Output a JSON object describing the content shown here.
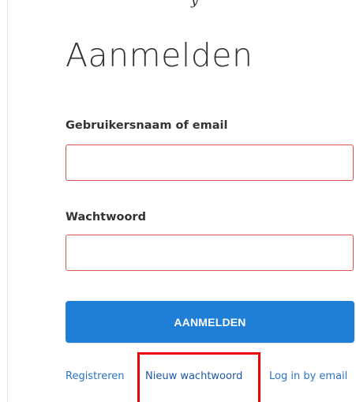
{
  "top_fragment": "y",
  "login": {
    "title": "Aanmelden",
    "username_label": "Gebruikersnaam of email",
    "username_value": "",
    "password_label": "Wachtwoord",
    "password_value": "",
    "submit_label": "AANMELDEN"
  },
  "links": {
    "register": "Registreren",
    "new_password": "Nieuw wachtwoord",
    "email_login": "Log in by email"
  },
  "colors": {
    "primary_button": "#1f7fd6",
    "input_error_border": "#d9534f",
    "link": "#2a74c2",
    "highlight_box": "#e8000b"
  }
}
